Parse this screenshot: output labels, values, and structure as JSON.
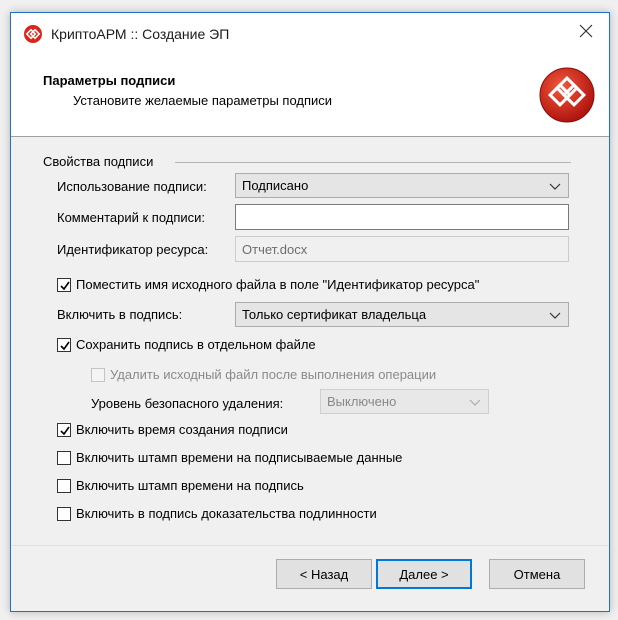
{
  "window": {
    "title": "КриптоАРМ :: Создание ЭП",
    "close_icon": "close-icon",
    "app_icon": "cryptoarm-logo-icon"
  },
  "header": {
    "title": "Параметры подписи",
    "subtitle": "Установите желаемые параметры подписи",
    "logo_icon": "cryptoarm-logo-icon"
  },
  "group": {
    "title": "Свойства подписи"
  },
  "fields": {
    "usage": {
      "label": "Использование подписи:",
      "value": "Подписано"
    },
    "comment": {
      "label": "Комментарий к подписи:",
      "value": ""
    },
    "resource": {
      "label": "Идентификатор ресурса:",
      "value": "Отчет.docx"
    },
    "include": {
      "label": "Включить в подпись:",
      "value": "Только сертификат владельца"
    },
    "secure_delete": {
      "label": "Уровень безопасного удаления:",
      "value": "Выключено"
    }
  },
  "checks": {
    "put_filename": {
      "label": "Поместить имя исходного файла в поле \"Идентификатор ресурса\"",
      "checked": true
    },
    "save_separate": {
      "label": "Сохранить подпись в отдельном файле",
      "checked": true
    },
    "delete_source": {
      "label": "Удалить исходный файл после выполнения операции",
      "checked": false
    },
    "include_time": {
      "label": "Включить время создания подписи",
      "checked": true
    },
    "stamp_data": {
      "label": "Включить штамп времени на подписываемые данные",
      "checked": false
    },
    "stamp_sign": {
      "label": "Включить штамп времени на подпись",
      "checked": false
    },
    "evidence": {
      "label": "Включить в подпись доказательства подлинности",
      "checked": false
    }
  },
  "buttons": {
    "back": "< Назад",
    "next": "Далее >",
    "cancel": "Отмена"
  },
  "colors": {
    "accent": "#0078d7",
    "logo_red": "#d9261c"
  }
}
